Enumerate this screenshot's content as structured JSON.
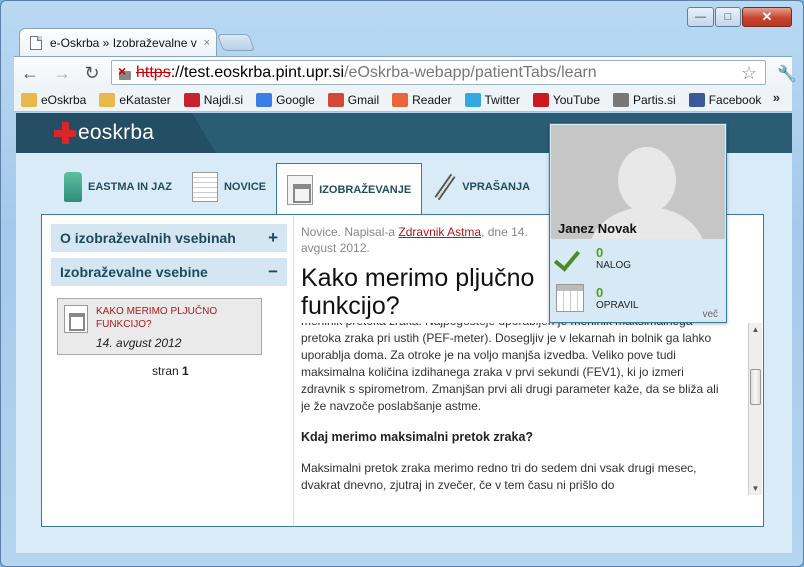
{
  "window": {
    "min_label": "—",
    "max_label": "□",
    "close_label": "✕"
  },
  "tab": {
    "title": "e-Oskrba » Izobraževalne v",
    "close": "×"
  },
  "address": {
    "scheme": "https",
    "host": "://test.eoskrba.pint.upr.si",
    "path": "/eOskrba-webapp/patientTabs/learn"
  },
  "bookmarks": [
    {
      "label": "eOskrba",
      "icon": "folder-icon",
      "color": "#e8b84a"
    },
    {
      "label": "eKataster",
      "icon": "folder-icon",
      "color": "#e8b84a"
    },
    {
      "label": "Najdi.si",
      "icon": "najdi-icon",
      "color": "#c8202c"
    },
    {
      "label": "Google",
      "icon": "google-icon",
      "color": "#3b7de8"
    },
    {
      "label": "Gmail",
      "icon": "gmail-icon",
      "color": "#d44638"
    },
    {
      "label": "Reader",
      "icon": "reader-icon",
      "color": "#e8663a"
    },
    {
      "label": "Twitter",
      "icon": "twitter-icon",
      "color": "#33a9e0"
    },
    {
      "label": "YouTube",
      "icon": "youtube-icon",
      "color": "#cc181e"
    },
    {
      "label": "Partis.si",
      "icon": "partis-icon",
      "color": "#777777"
    },
    {
      "label": "Facebook",
      "icon": "facebook-icon",
      "color": "#3b5998"
    }
  ],
  "bookmarks_more": "»",
  "site": {
    "logo_text": "eoskrba"
  },
  "nav": [
    {
      "label": "EASTMA IN JAZ"
    },
    {
      "label": "NOVICE"
    },
    {
      "label": "IZOBRAŽEVANJE"
    },
    {
      "label": "VPRAŠANJA"
    }
  ],
  "sidebar": {
    "section1": "O izobraževalnih vsebinah",
    "section1_sign": "+",
    "section2": "Izobraževalne vsebine",
    "section2_sign": "−",
    "lesson_title": "KAKO MERIMO PLJUČNO FUNKCIJO?",
    "lesson_date": "14. avgust 2012",
    "pager_label": "stran",
    "pager_num": "1"
  },
  "article": {
    "meta_prefix": "Novice. Napisal-a",
    "meta_author": "Zdravnik Astma",
    "meta_suffix": ", dne 14. avgust 2012.",
    "title": "Kako merimo pljučno funkcijo?",
    "para_top": "merilnik pretoka zraka. Najpogosteje uporabljen je merilnik maksimalnega pretoka zraka pri ustih (PEF-meter). Dosegljiv je v lekarnah in bolnik ga lahko uporablja doma. Za otroke je na voljo manjša izvedba. Veliko pove tudi maksimalna količina izdihanega zraka v prvi sekundi (FEV1), ki jo izmeri zdravnik s spirometrom. Zmanjšan prvi ali drugi parameter kaže, da se bliža ali je že navzoče poslabšanje astme.",
    "heading": "Kdaj merimo maksimalni pretok zraka?",
    "para_bottom": "Maksimalni pretok zraka merimo redno tri do sedem dni vsak drugi mesec, dvakrat dnevno, zjutraj in zvečer, če v tem času ni prišlo do"
  },
  "user": {
    "name": "Janez Novak",
    "tasks_count": "0",
    "tasks_label": "NALOG",
    "done_count": "0",
    "done_label": "OPRAVIL",
    "more": "več"
  }
}
